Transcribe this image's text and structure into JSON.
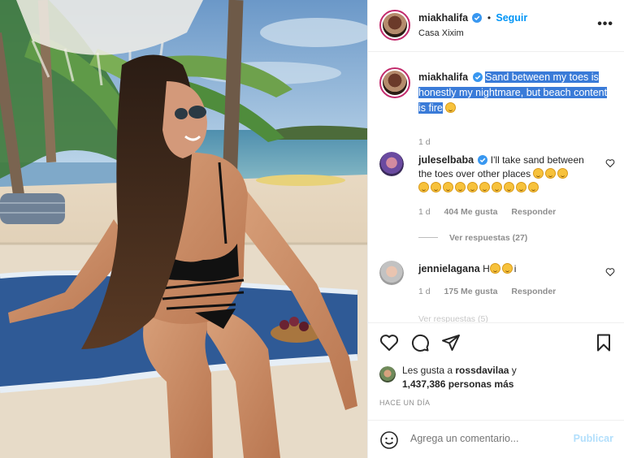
{
  "post": {
    "photo_label": "photo-beach"
  },
  "header": {
    "username": "miakhalifa",
    "separator": "•",
    "follow_label": "Seguir",
    "location": "Casa Xixim",
    "more_icon": "more-icon",
    "more_label": "•••"
  },
  "caption": {
    "username": "miakhalifa",
    "text": "Sand between my toes is honestly my nightmare, but beach content is fire",
    "time": "1 d"
  },
  "comments": [
    {
      "username": "juleselbaba",
      "text": "I'll take sand between the toes over other places",
      "time": "1 d",
      "likes": "404 Me gusta",
      "reply_label": "Responder"
    },
    {
      "username": "jennielagana",
      "text_before": "H",
      "text_after": "i",
      "time": "1 d",
      "likes": "175 Me gusta",
      "reply_label": "Responder"
    }
  ],
  "view_replies": "Ver respuestas (27)",
  "cut_text": "Ver respuestas (5)",
  "likes": {
    "prefix": "Les gusta a ",
    "user": "rossdavilaa",
    "connector": " y",
    "count": "1,437,386 personas más"
  },
  "posted_ago": "HACE UN DÍA",
  "add_comment": {
    "placeholder": "Agrega un comentario...",
    "post_label": "Publicar"
  },
  "colors": {
    "accent": "#0095f6",
    "highlight": "#3a7bd8",
    "ring": "#c22a6c"
  }
}
